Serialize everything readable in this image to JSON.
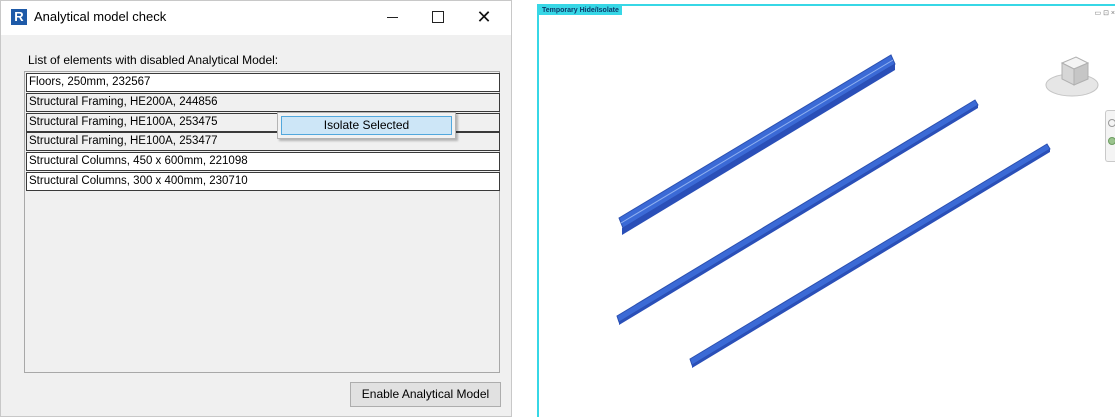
{
  "dialog": {
    "title": "Analytical model check",
    "app_logo_text": "R",
    "list_label": "List of elements with disabled Analytical Model:",
    "items": [
      "Floors, 250mm, 232567",
      "Structural Framing, HE200A, 244856",
      "Structural Framing, HE100A, 253475",
      "Structural Framing, HE100A, 253477",
      "Structural Columns, 450 x 600mm, 221098",
      "Structural Columns, 300 x 400mm, 230710"
    ],
    "context_menu": {
      "item": "Isolate Selected"
    },
    "enable_button": "Enable Analytical Model",
    "window_buttons": {
      "minimize": "minimize-icon",
      "maximize": "maximize-icon",
      "close": "close-icon"
    }
  },
  "viewport": {
    "tag": "Temporary Hide/Isolate",
    "controls": "▭ ⊡ ×",
    "beam_color": "#3b6ad6",
    "frame_color": "#37d7e6"
  }
}
